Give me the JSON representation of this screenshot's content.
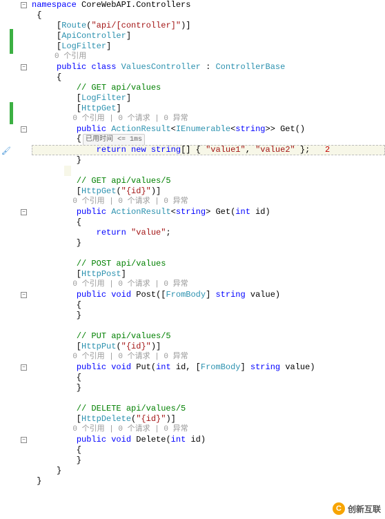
{
  "ns_kw": "namespace",
  "ns_name": "CoreWebAPI.Controllers",
  "attrs": {
    "route": "Route",
    "route_arg": "\"api/[controller]\"",
    "apicontroller": "ApiController",
    "logfilter": "LogFilter",
    "httpget": "HttpGet",
    "httpget_id_arg": "\"{id}\"",
    "httppost": "HttpPost",
    "httpput": "HttpPut",
    "httpput_arg": "\"{id}\"",
    "httpdelete": "HttpDelete",
    "httpdelete_arg": "\"{id}\"",
    "frombody": "FromBody"
  },
  "lens": {
    "refs0": "0 个引用",
    "refs_req_ex": "0 个引用 | 0 个请求 | 0 异常"
  },
  "class": {
    "public": "public",
    "class_kw": "class",
    "name": "ValuesController",
    "base": "ControllerBase"
  },
  "comments": {
    "get_values": "// GET api/values",
    "get_values_id": "// GET api/values/5",
    "post_values": "// POST api/values",
    "put_values": "// PUT api/values/5",
    "delete_values": "// DELETE api/values/5"
  },
  "methods": {
    "get1": {
      "public": "public",
      "ret_outer": "ActionResult",
      "ret_inner": "IEnumerable",
      "ret_gen": "string",
      "name": "Get",
      "return_kw": "return",
      "new_kw": "new",
      "arr_type": "string",
      "val1": "\"value1\"",
      "val2": "\"value2\"",
      "hint": "已用时间 <= 1ms",
      "annot": "2"
    },
    "get2": {
      "public": "public",
      "ret": "ActionResult",
      "ret_gen": "string",
      "name": "Get",
      "param_type": "int",
      "param_name": "id",
      "return_kw": "return",
      "val": "\"value\""
    },
    "post": {
      "public": "public",
      "void": "void",
      "name": "Post",
      "param_type": "string",
      "param_name": "value"
    },
    "put": {
      "public": "public",
      "void": "void",
      "name": "Put",
      "p1_type": "int",
      "p1_name": "id",
      "p2_type": "string",
      "p2_name": "value"
    },
    "del": {
      "public": "public",
      "void": "void",
      "name": "Delete",
      "p_type": "int",
      "p_name": "id"
    }
  },
  "watermark": "创新互联",
  "watermark_logo": "C"
}
